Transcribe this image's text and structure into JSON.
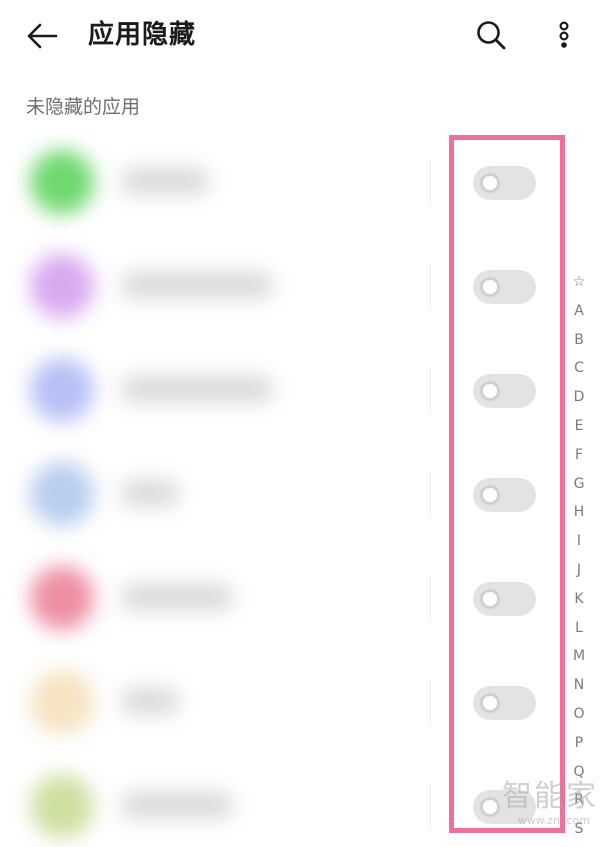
{
  "header": {
    "title": "应用隐藏",
    "back_icon": "arrow-left-icon",
    "search_icon": "search-icon",
    "more_icon": "more-vertical-icon"
  },
  "section": {
    "label": "未隐藏的应用"
  },
  "apps": [
    {
      "icon_color": "#6fd870",
      "toggle_state": "off"
    },
    {
      "icon_color": "#d9a9f0",
      "toggle_state": "off"
    },
    {
      "icon_color": "#b7c0f5",
      "toggle_state": "off"
    },
    {
      "icon_color": "#b9cdef",
      "toggle_state": "off"
    },
    {
      "icon_color": "#ee8fa3",
      "toggle_state": "off"
    },
    {
      "icon_color": "#f6e3c2",
      "toggle_state": "off"
    },
    {
      "icon_color": "#cfe0a3",
      "toggle_state": "off"
    }
  ],
  "alpha_index": [
    "☆",
    "A",
    "B",
    "C",
    "D",
    "E",
    "F",
    "G",
    "H",
    "I",
    "J",
    "K",
    "L",
    "M",
    "N",
    "O",
    "P",
    "Q",
    "R",
    "S"
  ],
  "highlight_color": "#ee6f9b",
  "watermark": {
    "main": "智能家",
    "sub": "www.znj.com"
  }
}
